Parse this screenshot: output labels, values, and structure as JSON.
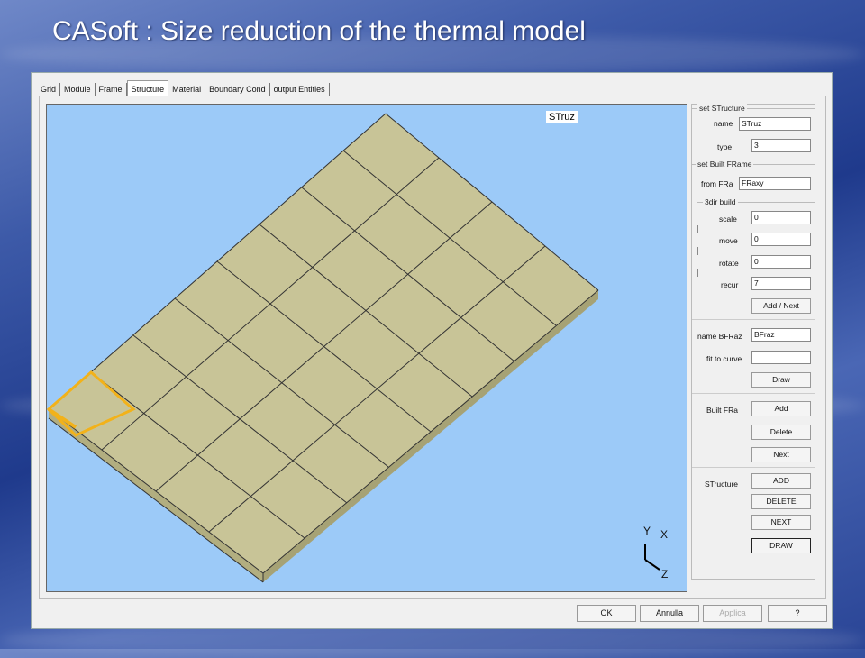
{
  "slide_title": "CASoft : Size reduction of the thermal model",
  "tabs": [
    "Grid",
    "Module",
    "Frame",
    "Structure",
    "Material",
    "Boundary Cond",
    "output Entities"
  ],
  "active_tab": "Structure",
  "viewport": {
    "structure_label": "STruz",
    "axes": {
      "y": "Y",
      "x": "X",
      "z": "Z"
    }
  },
  "sidebar": {
    "set_structure": {
      "title": "set STructure",
      "name_label": "name",
      "name_value": "STruz",
      "type_label": "type",
      "type_value": "3"
    },
    "set_built_frame": {
      "title": "set Built FRame",
      "from_label": "from FRa",
      "from_value": "FRaxy"
    },
    "dir_build": {
      "title": "3dir build",
      "scale_label": "scale",
      "scale_value": "0",
      "move_label": "move",
      "move_value": "0",
      "rotate_label": "rotate",
      "rotate_value": "0",
      "recur_label": "recur",
      "recur_value": "7",
      "add_next": "Add / Next"
    },
    "name_bfraz_label": "name BFRaz",
    "name_bfraz_value": "BFraz",
    "fit_label": "fit to curve",
    "fit_value": "",
    "draw_label": "Draw",
    "built_fra": {
      "label": "Built FRa",
      "add": "Add",
      "delete": "Delete",
      "next": "Next"
    },
    "structure": {
      "label": "STructure",
      "add": "ADD",
      "delete": "DELETE",
      "next": "NEXT",
      "draw": "DRAW"
    }
  },
  "bottom": {
    "ok": "OK",
    "annulla": "Annulla",
    "applica": "Applica",
    "help": "?"
  }
}
